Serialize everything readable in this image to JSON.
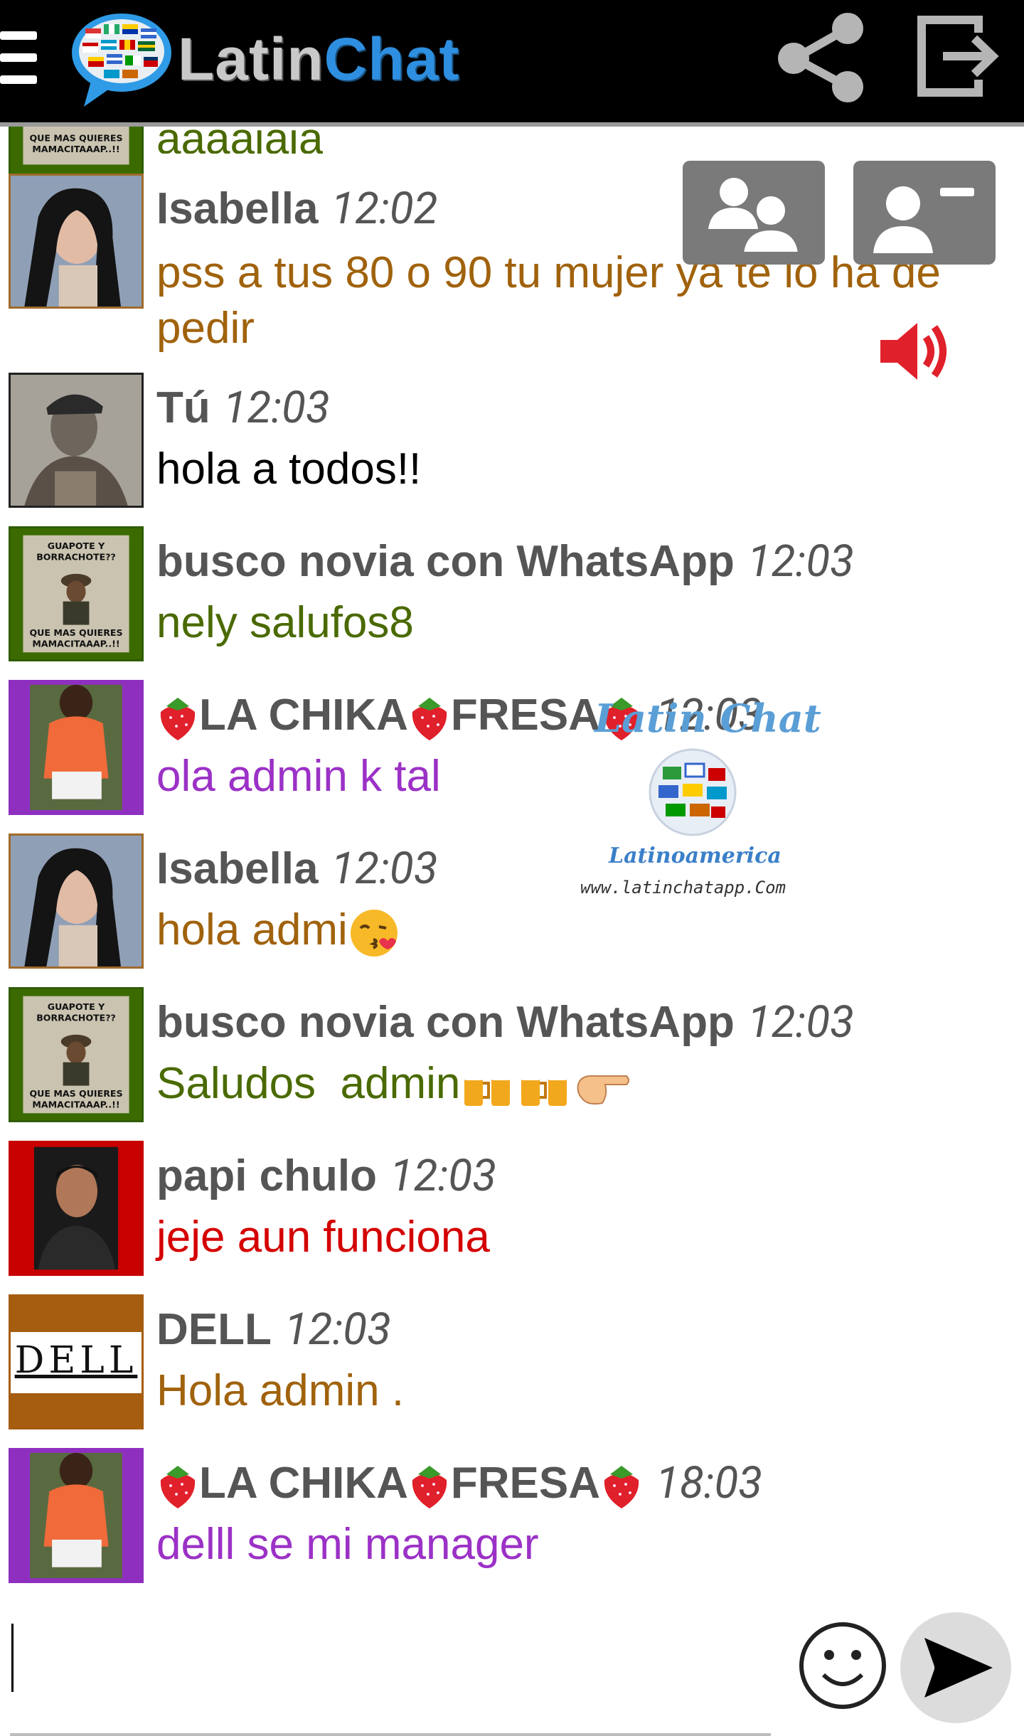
{
  "app": {
    "title_part1": "Latin",
    "title_part2": "Chat"
  },
  "icons": {
    "menu": "hamburger-menu-icon",
    "share": "share-icon",
    "logout": "logout-icon",
    "users": "users-group-icon",
    "remove_user": "remove-user-icon",
    "sound": "speaker-volume-icon",
    "emoji": "smiley-icon",
    "send": "send-arrow-icon"
  },
  "colors": {
    "topbar": "#000000",
    "brown_text": "#a0620c",
    "green_text": "#4a6a00",
    "purple_text": "#9b31c6",
    "red_text": "#d40000",
    "logo_blue": "#2e8fe0"
  },
  "watermark": {
    "title": "Latin Chat",
    "subtitle": "Latinoamerica",
    "url": "www.latinchatapp.Com"
  },
  "messages": [
    {
      "name": "",
      "time": "",
      "text": "aaaajaja",
      "color": "green"
    },
    {
      "name": "Isabella",
      "time": "12:02",
      "text_line1": "pss a tus 80 o 90 tu mujer ya te lo ha de",
      "text_line2": "pedir",
      "color": "brown"
    },
    {
      "name": "Tú",
      "time": "12:03",
      "text": "hola a todos!!",
      "color": "black"
    },
    {
      "name": "busco novia con WhatsApp",
      "time": "12:03",
      "text": "nely salufos8",
      "color": "green"
    },
    {
      "name": "LA CHIKA",
      "name2": "FRESA",
      "time": "12:03",
      "text": "ola admin k tal",
      "color": "purple"
    },
    {
      "name": "Isabella",
      "time": "12:03",
      "text": "hola admi",
      "color": "brown"
    },
    {
      "name": "busco novia con WhatsApp",
      "time": "12:03",
      "text": "Saludos  admin",
      "color": "green"
    },
    {
      "name": "papi chulo",
      "time": "12:03",
      "text": "jeje aun funciona",
      "color": "red"
    },
    {
      "name": "DELL",
      "time": "12:03",
      "text": "Hola admin .",
      "color": "brown",
      "avatar_text": "DELL"
    },
    {
      "name": "LA CHIKA",
      "name2": "FRESA",
      "time": "18:03",
      "text": "delll se mi manager",
      "color": "purple"
    }
  ],
  "avatar_captions": {
    "meme_top": "GUAPOTE Y BORRACHOTE??",
    "meme_bottom": "QUE MAS QUIERES MAMACITAAAP..!!"
  },
  "input": {
    "value": "",
    "placeholder": ""
  }
}
